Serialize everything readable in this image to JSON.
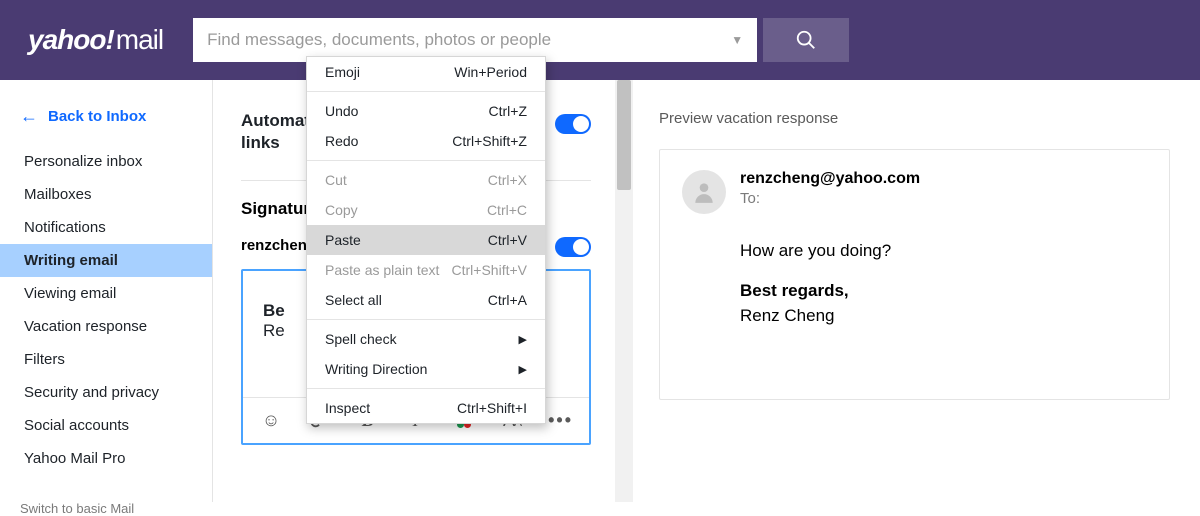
{
  "header": {
    "logo_main": "yahoo!",
    "logo_sub": "mail",
    "search_placeholder": "Find messages, documents, photos or people"
  },
  "back_link": "Back to Inbox",
  "sidebar": {
    "items": [
      {
        "label": "Personalize inbox"
      },
      {
        "label": "Mailboxes"
      },
      {
        "label": "Notifications"
      },
      {
        "label": "Writing email"
      },
      {
        "label": "Viewing email"
      },
      {
        "label": "Vacation response"
      },
      {
        "label": "Filters"
      },
      {
        "label": "Security and privacy"
      },
      {
        "label": "Social accounts"
      },
      {
        "label": "Yahoo Mail Pro"
      }
    ],
    "active_index": 3,
    "switch_basic": "Switch to basic Mail"
  },
  "settings": {
    "auto_link_title_line1": "Automat",
    "auto_link_title_line2": "links",
    "signature_heading": "Signatur",
    "signature_email_truncated": "renzcheng",
    "signature_text_bold_truncated": "Be",
    "signature_text_line2_truncated": "Re"
  },
  "preview": {
    "label": "Preview vacation response",
    "from_email": "renzcheng@yahoo.com",
    "to_label": "To:",
    "body_greeting": "How are you doing?",
    "body_signoff_bold": "Best regards,",
    "body_name": "Renz Cheng"
  },
  "context_menu": {
    "items": [
      {
        "label": "Emoji",
        "shortcut": "Win+Period",
        "group": 0
      },
      {
        "label": "Undo",
        "shortcut": "Ctrl+Z",
        "group": 1
      },
      {
        "label": "Redo",
        "shortcut": "Ctrl+Shift+Z",
        "group": 1
      },
      {
        "label": "Cut",
        "shortcut": "Ctrl+X",
        "group": 2,
        "disabled": true
      },
      {
        "label": "Copy",
        "shortcut": "Ctrl+C",
        "group": 2,
        "disabled": true
      },
      {
        "label": "Paste",
        "shortcut": "Ctrl+V",
        "group": 2,
        "hover": true
      },
      {
        "label": "Paste as plain text",
        "shortcut": "Ctrl+Shift+V",
        "group": 2,
        "disabled": true
      },
      {
        "label": "Select all",
        "shortcut": "Ctrl+A",
        "group": 2
      },
      {
        "label": "Spell check",
        "submenu": true,
        "group": 3
      },
      {
        "label": "Writing Direction",
        "submenu": true,
        "group": 3
      },
      {
        "label": "Inspect",
        "shortcut": "Ctrl+Shift+I",
        "group": 4
      }
    ]
  }
}
